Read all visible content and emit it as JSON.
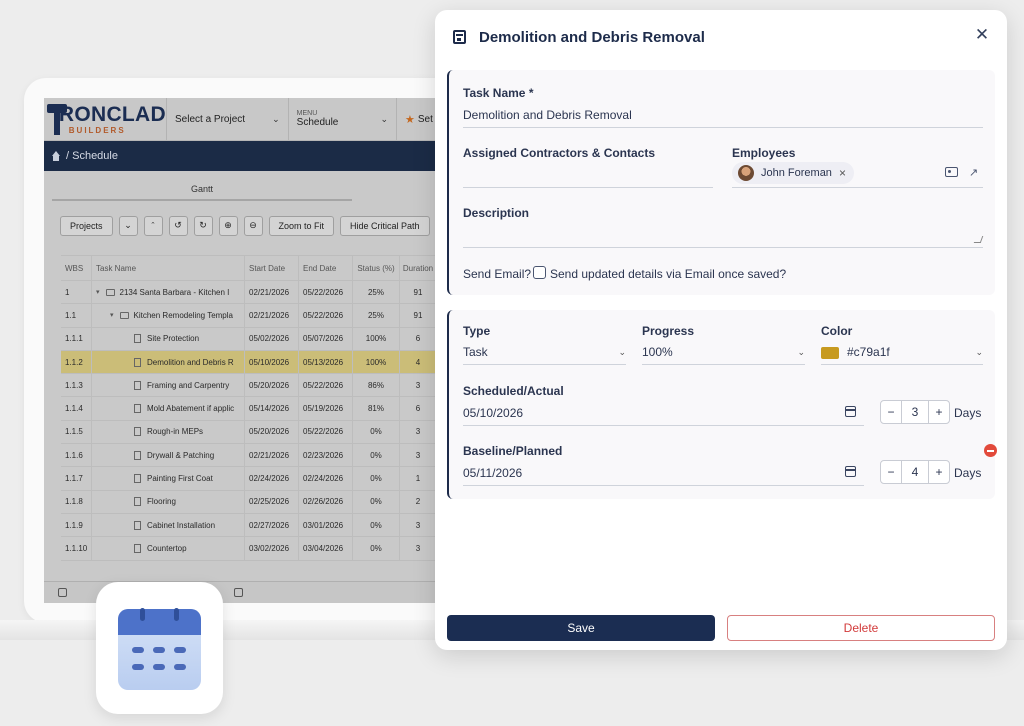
{
  "app": {
    "logo_main": "IRONCLAD",
    "logo_sub": "BUILDERS",
    "project_select": "Select a Project",
    "menu_label": "MENU",
    "menu_value": "Schedule",
    "settings_partial": "Set",
    "breadcrumb": "/ Schedule",
    "gantt_tab": "Gantt"
  },
  "toolbar": {
    "projects": "Projects",
    "zoom_fit": "Zoom to Fit",
    "hide_critical": "Hide Critical Path"
  },
  "grid": {
    "headers": [
      "WBS",
      "Task Name",
      "Start Date",
      "End Date",
      "Status (%)",
      "Duration"
    ],
    "rows": [
      {
        "wbs": "1",
        "name": "2134 Santa Barbara - Kitchen I",
        "start": "02/21/2026",
        "end": "05/22/2026",
        "status": "25%",
        "dur": "91"
      },
      {
        "wbs": "1.1",
        "name": "Kitchen Remodeling Templa",
        "start": "02/21/2026",
        "end": "05/22/2026",
        "status": "25%",
        "dur": "91"
      },
      {
        "wbs": "1.1.1",
        "name": "Site Protection",
        "start": "05/02/2026",
        "end": "05/07/2026",
        "status": "100%",
        "dur": "6"
      },
      {
        "wbs": "1.1.2",
        "name": "Demolition and Debris R",
        "start": "05/10/2026",
        "end": "05/13/2026",
        "status": "100%",
        "dur": "4"
      },
      {
        "wbs": "1.1.3",
        "name": "Framing and Carpentry",
        "start": "05/20/2026",
        "end": "05/22/2026",
        "status": "86%",
        "dur": "3"
      },
      {
        "wbs": "1.1.4",
        "name": "Mold Abatement if applic",
        "start": "05/14/2026",
        "end": "05/19/2026",
        "status": "81%",
        "dur": "6"
      },
      {
        "wbs": "1.1.5",
        "name": "Rough-in MEPs",
        "start": "05/20/2026",
        "end": "05/22/2026",
        "status": "0%",
        "dur": "3"
      },
      {
        "wbs": "1.1.6",
        "name": "Drywall & Patching",
        "start": "02/21/2026",
        "end": "02/23/2026",
        "status": "0%",
        "dur": "3"
      },
      {
        "wbs": "1.1.7",
        "name": "Painting First Coat",
        "start": "02/24/2026",
        "end": "02/24/2026",
        "status": "0%",
        "dur": "1"
      },
      {
        "wbs": "1.1.8",
        "name": "Flooring",
        "start": "02/25/2026",
        "end": "02/26/2026",
        "status": "0%",
        "dur": "2"
      },
      {
        "wbs": "1.1.9",
        "name": "Cabinet Installation",
        "start": "02/27/2026",
        "end": "03/01/2026",
        "status": "0%",
        "dur": "3"
      },
      {
        "wbs": "1.1.10",
        "name": "Countertop",
        "start": "03/02/2026",
        "end": "03/04/2026",
        "status": "0%",
        "dur": "3"
      }
    ]
  },
  "modal": {
    "title": "Demolition and Debris Removal",
    "task_name_label": "Task Name *",
    "task_name_value": "Demolition and Debris Removal",
    "contractors_label": "Assigned Contractors & Contacts",
    "employees_label": "Employees",
    "employee_chip": "John Foreman",
    "description_label": "Description",
    "send_email_label": "Send Email?",
    "send_email_option": "Send updated details via Email once saved?",
    "type_label": "Type",
    "type_value": "Task",
    "progress_label": "Progress",
    "progress_value": "100%",
    "color_label": "Color",
    "color_value": "#c79a1f",
    "scheduled_label": "Scheduled/Actual",
    "scheduled_date": "05/10/2026",
    "scheduled_days": "3",
    "baseline_label": "Baseline/Planned",
    "baseline_date": "05/11/2026",
    "baseline_days": "4",
    "days_unit": "Days",
    "save": "Save",
    "delete": "Delete"
  },
  "colors": {
    "navy": "#1b2d52",
    "highlight_row": "#cbbd78",
    "task_color": "#c79a1f",
    "delete_red": "#d23a3a"
  }
}
